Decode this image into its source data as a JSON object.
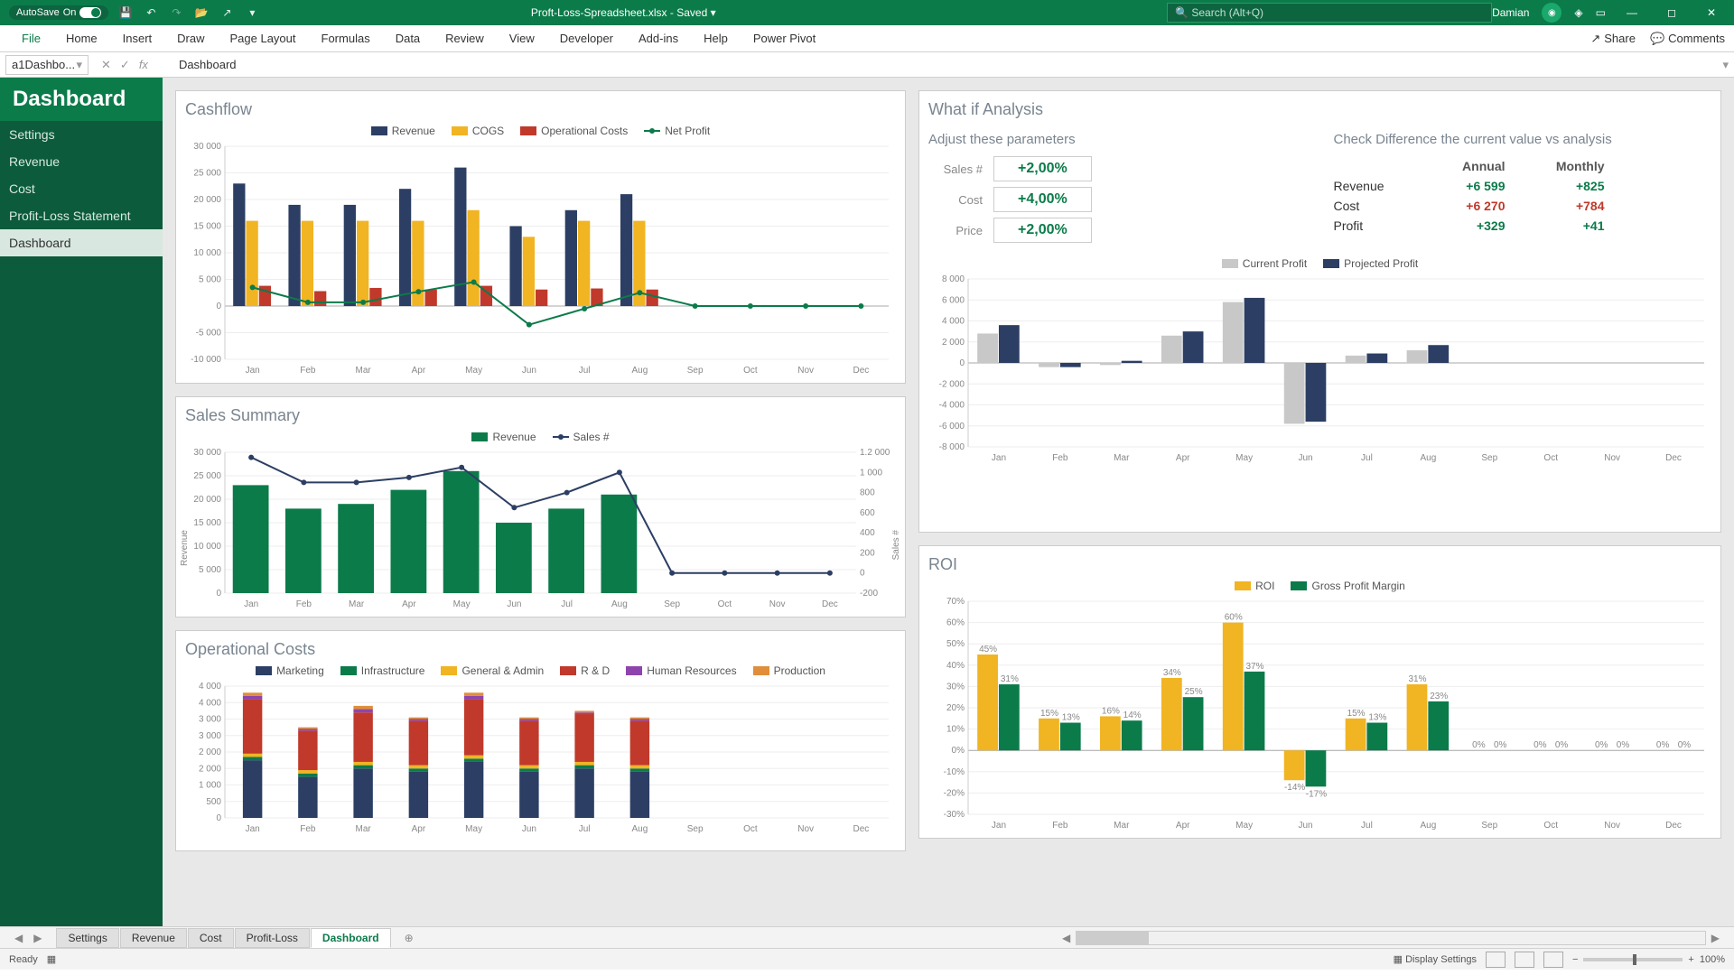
{
  "titlebar": {
    "autosave": "AutoSave",
    "on": "On",
    "filename": "Proft-Loss-Spreadsheet.xlsx",
    "saved": "Saved",
    "search_ph": "Search (Alt+Q)",
    "user": "Damian"
  },
  "ribbon": {
    "tabs": [
      "File",
      "Home",
      "Insert",
      "Draw",
      "Page Layout",
      "Formulas",
      "Data",
      "Review",
      "View",
      "Developer",
      "Add-ins",
      "Help",
      "Power Pivot"
    ],
    "share": "Share",
    "comments": "Comments"
  },
  "formula": {
    "name": "a1Dashbo...",
    "fx": "fx",
    "val": "Dashboard"
  },
  "sidebar": {
    "hdr": "Dashboard",
    "items": [
      "Settings",
      "Revenue",
      "Cost",
      "Profit-Loss Statement",
      "Dashboard"
    ]
  },
  "cashflow": {
    "title": "Cashflow",
    "legend": [
      "Revenue",
      "COGS",
      "Operational Costs",
      "Net Profit"
    ]
  },
  "sales": {
    "title": "Sales Summary",
    "legend": [
      "Revenue",
      "Sales #"
    ],
    "ylabel": "Revenue",
    "ylabel2": "Sales #"
  },
  "opcost": {
    "title": "Operational Costs",
    "legend": [
      "Marketing",
      "Infrastructure",
      "General & Admin",
      "R & D",
      "Human Resources",
      "Production"
    ]
  },
  "whatif": {
    "title": "What if Analysis",
    "adj": "Adjust these parameters",
    "check": "Check Difference the current value vs analysis",
    "params": [
      {
        "l": "Sales #",
        "v": "+2,00%"
      },
      {
        "l": "Cost",
        "v": "+4,00%"
      },
      {
        "l": "Price",
        "v": "+2,00%"
      }
    ],
    "diffhdr": [
      "",
      "Annual",
      "Monthly"
    ],
    "diff": [
      {
        "l": "Revenue",
        "a": "+6 599",
        "m": "+825",
        "cls": "pos"
      },
      {
        "l": "Cost",
        "a": "+6 270",
        "m": "+784",
        "cls": "neg"
      },
      {
        "l": "Profit",
        "a": "+329",
        "m": "+41",
        "cls": "pos"
      }
    ],
    "plegend": [
      "Current Profit",
      "Projected Profit"
    ]
  },
  "roi": {
    "title": "ROI",
    "legend": [
      "ROI",
      "Gross Profit Margin"
    ]
  },
  "months": [
    "Jan",
    "Feb",
    "Mar",
    "Apr",
    "May",
    "Jun",
    "Jul",
    "Aug",
    "Sep",
    "Oct",
    "Nov",
    "Dec"
  ],
  "sheettabs": [
    "Settings",
    "Revenue",
    "Cost",
    "Profit-Loss",
    "Dashboard"
  ],
  "status": {
    "ready": "Ready",
    "disp": "Display Settings",
    "zoom": "100%"
  },
  "chart_data": [
    {
      "type": "bar",
      "name": "cashflow",
      "categories": [
        "Jan",
        "Feb",
        "Mar",
        "Apr",
        "May",
        "Jun",
        "Jul",
        "Aug",
        "Sep",
        "Oct",
        "Nov",
        "Dec"
      ],
      "series": [
        {
          "name": "Revenue",
          "values": [
            23000,
            19000,
            19000,
            22000,
            26000,
            15000,
            18000,
            21000,
            0,
            0,
            0,
            0
          ],
          "color": "#2c3e63"
        },
        {
          "name": "COGS",
          "values": [
            16000,
            16000,
            16000,
            16000,
            18000,
            13000,
            16000,
            16000,
            0,
            0,
            0,
            0
          ],
          "color": "#f1b422"
        },
        {
          "name": "Operational Costs",
          "values": [
            3800,
            2800,
            3400,
            3100,
            3800,
            3100,
            3300,
            3100,
            0,
            0,
            0,
            0
          ],
          "color": "#c0392b"
        },
        {
          "name": "Net Profit",
          "type": "line",
          "values": [
            3500,
            700,
            700,
            2700,
            4500,
            -3500,
            -500,
            2500,
            0,
            0,
            0,
            0
          ],
          "color": "#0b7b4a"
        }
      ],
      "ylim": [
        -10000,
        30000
      ],
      "ticks": [
        -10000,
        -5000,
        0,
        5000,
        10000,
        15000,
        20000,
        25000,
        30000
      ]
    },
    {
      "type": "bar",
      "name": "sales",
      "categories": [
        "Jan",
        "Feb",
        "Mar",
        "Apr",
        "May",
        "Jun",
        "Jul",
        "Aug",
        "Sep",
        "Oct",
        "Nov",
        "Dec"
      ],
      "series": [
        {
          "name": "Revenue",
          "values": [
            23000,
            18000,
            19000,
            22000,
            26000,
            15000,
            18000,
            21000,
            0,
            0,
            0,
            0
          ],
          "color": "#0b7b4a"
        },
        {
          "name": "Sales #",
          "type": "line",
          "axis": "y2",
          "values": [
            1150,
            900,
            900,
            950,
            1050,
            650,
            800,
            1000,
            0,
            0,
            0,
            0
          ],
          "color": "#2c3e63"
        }
      ],
      "ylim": [
        0,
        30000
      ],
      "y2lim": [
        -200,
        1200
      ],
      "ticks": [
        0,
        5000,
        10000,
        15000,
        20000,
        25000,
        30000
      ],
      "ticks2": [
        -200,
        0,
        200,
        400,
        600,
        800,
        1000,
        1200
      ]
    },
    {
      "type": "bar",
      "name": "opcost",
      "stacked": true,
      "categories": [
        "Jan",
        "Feb",
        "Mar",
        "Apr",
        "May",
        "Jun",
        "Jul",
        "Aug",
        "Sep",
        "Oct",
        "Nov",
        "Dec"
      ],
      "series": [
        {
          "name": "Marketing",
          "values": [
            1750,
            1250,
            1500,
            1400,
            1700,
            1400,
            1500,
            1400,
            0,
            0,
            0,
            0
          ],
          "color": "#2c3e63"
        },
        {
          "name": "Infrastructure",
          "values": [
            100,
            100,
            100,
            100,
            100,
            100,
            100,
            100,
            0,
            0,
            0,
            0
          ],
          "color": "#0b7b4a"
        },
        {
          "name": "General & Admin",
          "values": [
            100,
            100,
            100,
            100,
            100,
            100,
            100,
            100,
            0,
            0,
            0,
            0
          ],
          "color": "#f1b422"
        },
        {
          "name": "R & D",
          "values": [
            1650,
            1200,
            1500,
            1350,
            1700,
            1350,
            1450,
            1350,
            0,
            0,
            0,
            0
          ],
          "color": "#c0392b"
        },
        {
          "name": "Human Resources",
          "values": [
            100,
            50,
            100,
            50,
            100,
            50,
            50,
            50,
            0,
            0,
            0,
            0
          ],
          "color": "#8e44ad"
        },
        {
          "name": "Production",
          "values": [
            100,
            50,
            100,
            50,
            100,
            50,
            50,
            50,
            0,
            0,
            0,
            0
          ],
          "color": "#e08e3a"
        }
      ],
      "ylim": [
        0,
        4000
      ],
      "ticks": [
        0,
        500,
        1000,
        1500,
        2000,
        2500,
        3000,
        3500,
        4000
      ]
    },
    {
      "type": "bar",
      "name": "profit_projection",
      "categories": [
        "Jan",
        "Feb",
        "Mar",
        "Apr",
        "May",
        "Jun",
        "Jul",
        "Aug",
        "Sep",
        "Oct",
        "Nov",
        "Dec"
      ],
      "series": [
        {
          "name": "Current Profit",
          "values": [
            2800,
            -400,
            -200,
            2600,
            5800,
            -5800,
            700,
            1200,
            0,
            0,
            0,
            0
          ],
          "color": "#c8c8c8"
        },
        {
          "name": "Projected Profit",
          "values": [
            3600,
            -400,
            200,
            3000,
            6200,
            -5600,
            900,
            1700,
            0,
            0,
            0,
            0
          ],
          "color": "#2c3e63"
        }
      ],
      "ylim": [
        -8000,
        8000
      ],
      "ticks": [
        -8000,
        -6000,
        -4000,
        -2000,
        0,
        2000,
        4000,
        6000,
        8000
      ]
    },
    {
      "type": "bar",
      "name": "roi",
      "categories": [
        "Jan",
        "Feb",
        "Mar",
        "Apr",
        "May",
        "Jun",
        "Jul",
        "Aug",
        "Sep",
        "Oct",
        "Nov",
        "Dec"
      ],
      "series": [
        {
          "name": "ROI",
          "values": [
            45,
            15,
            16,
            34,
            60,
            -14,
            15,
            31,
            0,
            0,
            0,
            0
          ],
          "color": "#f1b422",
          "labels": [
            "45%",
            "15%",
            "16%",
            "34%",
            "60%",
            "-14%",
            "15%",
            "31%",
            "0%",
            "0%",
            "0%",
            "0%"
          ]
        },
        {
          "name": "Gross Profit Margin",
          "values": [
            31,
            13,
            14,
            25,
            37,
            -17,
            13,
            23,
            0,
            0,
            0,
            0
          ],
          "color": "#0b7b4a",
          "labels": [
            "31%",
            "13%",
            "14%",
            "25%",
            "37%",
            "-17%",
            "13%",
            "23%",
            "0%",
            "0%",
            "0%",
            "0%"
          ]
        }
      ],
      "ylim": [
        -30,
        70
      ],
      "ticks": [
        -30,
        -20,
        -10,
        0,
        10,
        20,
        30,
        40,
        50,
        60,
        70
      ]
    }
  ]
}
